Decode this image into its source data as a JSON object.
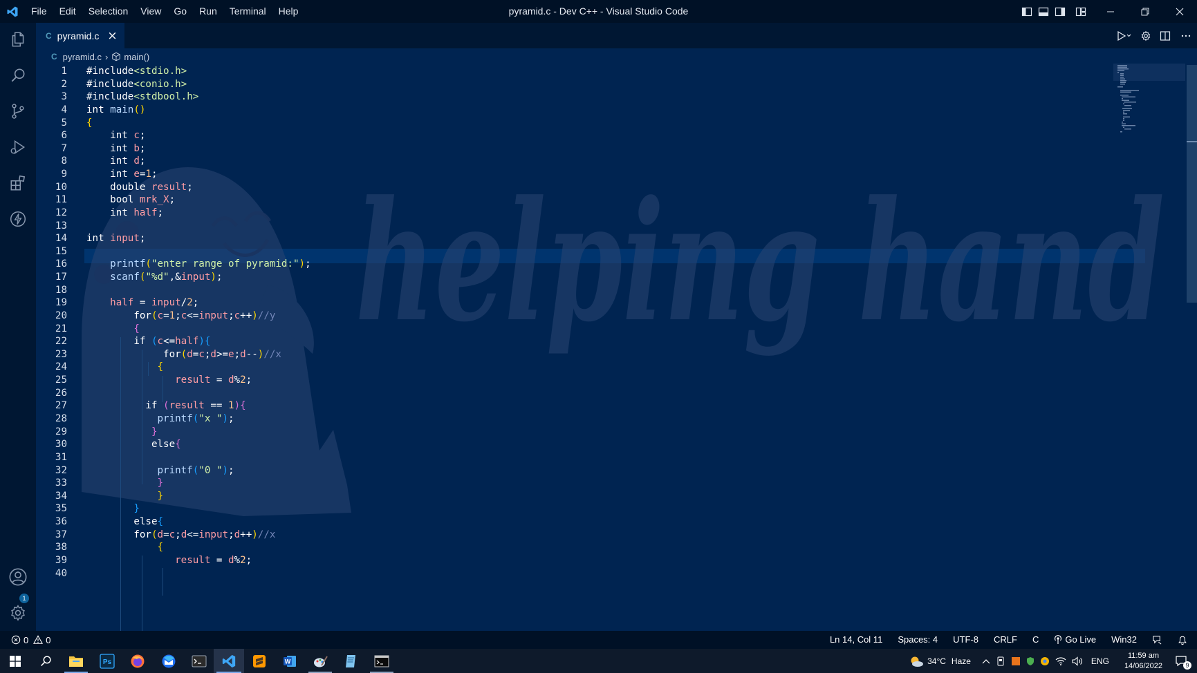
{
  "colors": {
    "editor_bg": "#002451",
    "keyword": "#ffffff",
    "string": "#d1f1a9",
    "function": "#bbdaff",
    "bracket_yellow": "#ffd700",
    "bracket_pink": "#da70d6",
    "bracket_blue": "#179fff",
    "comment": "#7285b7",
    "variable": "#ff9da4",
    "number": "#ffc58f"
  },
  "titlebar": {
    "menu": [
      "File",
      "Edit",
      "Selection",
      "View",
      "Go",
      "Run",
      "Terminal",
      "Help"
    ],
    "title": "pyramid.c - Dev C++ - Visual Studio Code"
  },
  "tab": {
    "icon_text": "C",
    "label": "pyramid.c"
  },
  "breadcrumb": {
    "icon_text": "C",
    "file": "pyramid.c",
    "symbol": "main()"
  },
  "watermark": {
    "text": "helping hand"
  },
  "code": [
    {
      "ln": "1",
      "tokens": [
        [
          "#include",
          "#ffffff"
        ],
        [
          "<stdio.h>",
          "#d1f1a9"
        ]
      ]
    },
    {
      "ln": "2",
      "tokens": [
        [
          "#include",
          "#ffffff"
        ],
        [
          "<conio.h>",
          "#d1f1a9"
        ]
      ]
    },
    {
      "ln": "3",
      "tokens": [
        [
          "#include",
          "#ffffff"
        ],
        [
          "<stdbool.h>",
          "#d1f1a9"
        ]
      ]
    },
    {
      "ln": "4",
      "tokens": [
        [
          "int ",
          "#ffffff"
        ],
        [
          "main",
          "#bbdaff"
        ],
        [
          "()",
          "#ffd700"
        ]
      ]
    },
    {
      "ln": "5",
      "tokens": [
        [
          "{",
          "#ffd700"
        ]
      ]
    },
    {
      "ln": "6",
      "tokens": [
        [
          "    int ",
          "#ffffff"
        ],
        [
          "c",
          "#ff9da4"
        ],
        [
          ";",
          "#ffffff"
        ]
      ]
    },
    {
      "ln": "7",
      "tokens": [
        [
          "    int ",
          "#ffffff"
        ],
        [
          "b",
          "#ff9da4"
        ],
        [
          ";",
          "#ffffff"
        ]
      ]
    },
    {
      "ln": "8",
      "tokens": [
        [
          "    int ",
          "#ffffff"
        ],
        [
          "d",
          "#ff9da4"
        ],
        [
          ";",
          "#ffffff"
        ]
      ]
    },
    {
      "ln": "9",
      "tokens": [
        [
          "    int ",
          "#ffffff"
        ],
        [
          "e",
          "#ff9da4"
        ],
        [
          "=",
          "#ffffff"
        ],
        [
          "1",
          "#ffc58f"
        ],
        [
          ";",
          "#ffffff"
        ]
      ]
    },
    {
      "ln": "10",
      "tokens": [
        [
          "    double ",
          "#ffffff"
        ],
        [
          "result",
          "#ff9da4"
        ],
        [
          ";",
          "#ffffff"
        ]
      ]
    },
    {
      "ln": "11",
      "tokens": [
        [
          "    bool ",
          "#ffffff"
        ],
        [
          "mrk_X",
          "#ff9da4"
        ],
        [
          ";",
          "#ffffff"
        ]
      ]
    },
    {
      "ln": "12",
      "tokens": [
        [
          "    int ",
          "#ffffff"
        ],
        [
          "half",
          "#ff9da4"
        ],
        [
          ";",
          "#ffffff"
        ]
      ]
    },
    {
      "ln": "13",
      "tokens": []
    },
    {
      "ln": "14",
      "tokens": [
        [
          "int ",
          "#ffffff"
        ],
        [
          "input",
          "#ff9da4"
        ],
        [
          ";",
          "#ffffff"
        ]
      ]
    },
    {
      "ln": "15",
      "tokens": []
    },
    {
      "ln": "16",
      "tokens": [
        [
          "    ",
          "#ffffff"
        ],
        [
          "printf",
          "#bbdaff"
        ],
        [
          "(",
          "#ffd700"
        ],
        [
          "\"enter range of pyramid:\"",
          "#d1f1a9"
        ],
        [
          ")",
          "#ffd700"
        ],
        [
          ";",
          "#ffffff"
        ]
      ]
    },
    {
      "ln": "17",
      "tokens": [
        [
          "    ",
          "#ffffff"
        ],
        [
          "scanf",
          "#bbdaff"
        ],
        [
          "(",
          "#ffd700"
        ],
        [
          "\"%d\"",
          "#d1f1a9"
        ],
        [
          ",&",
          "#ffffff"
        ],
        [
          "input",
          "#ff9da4"
        ],
        [
          ")",
          "#ffd700"
        ],
        [
          ";",
          "#ffffff"
        ]
      ]
    },
    {
      "ln": "18",
      "tokens": []
    },
    {
      "ln": "19",
      "tokens": [
        [
          "    ",
          "#ffffff"
        ],
        [
          "half",
          "#ff9da4"
        ],
        [
          " = ",
          "#ffffff"
        ],
        [
          "input",
          "#ff9da4"
        ],
        [
          "/",
          "#ffffff"
        ],
        [
          "2",
          "#ffc58f"
        ],
        [
          ";",
          "#ffffff"
        ]
      ]
    },
    {
      "ln": "20",
      "tokens": [
        [
          "        ",
          "#ffffff"
        ],
        [
          "for",
          "#ffffff"
        ],
        [
          "(",
          "#ffd700"
        ],
        [
          "c",
          "#ff9da4"
        ],
        [
          "=",
          "#ffffff"
        ],
        [
          "1",
          "#ffc58f"
        ],
        [
          ";",
          "#ffffff"
        ],
        [
          "c",
          "#ff9da4"
        ],
        [
          "<=",
          "#ffffff"
        ],
        [
          "input",
          "#ff9da4"
        ],
        [
          ";",
          "#ffffff"
        ],
        [
          "c",
          "#ff9da4"
        ],
        [
          "++",
          "#ffffff"
        ],
        [
          ")",
          "#ffd700"
        ],
        [
          "//y",
          "#7285b7"
        ]
      ]
    },
    {
      "ln": "21",
      "tokens": [
        [
          "        ",
          "#ffffff"
        ],
        [
          "{",
          "#da70d6"
        ]
      ]
    },
    {
      "ln": "22",
      "tokens": [
        [
          "        ",
          "#ffffff"
        ],
        [
          "if ",
          "#ffffff"
        ],
        [
          "(",
          "#179fff"
        ],
        [
          "c",
          "#ff9da4"
        ],
        [
          "<=",
          "#ffffff"
        ],
        [
          "half",
          "#ff9da4"
        ],
        [
          ")",
          "#179fff"
        ],
        [
          "{",
          "#179fff"
        ]
      ]
    },
    {
      "ln": "23",
      "tokens": [
        [
          "             ",
          "#ffffff"
        ],
        [
          "for",
          "#ffffff"
        ],
        [
          "(",
          "#ffd700"
        ],
        [
          "d",
          "#ff9da4"
        ],
        [
          "=",
          "#ffffff"
        ],
        [
          "c",
          "#ff9da4"
        ],
        [
          ";",
          "#ffffff"
        ],
        [
          "d",
          "#ff9da4"
        ],
        [
          ">=",
          "#ffffff"
        ],
        [
          "e",
          "#ff9da4"
        ],
        [
          ";",
          "#ffffff"
        ],
        [
          "d",
          "#ff9da4"
        ],
        [
          "--",
          "#ffffff"
        ],
        [
          ")",
          "#ffd700"
        ],
        [
          "//x",
          "#7285b7"
        ]
      ]
    },
    {
      "ln": "24",
      "tokens": [
        [
          "            ",
          "#ffffff"
        ],
        [
          "{",
          "#ffd700"
        ]
      ]
    },
    {
      "ln": "25",
      "tokens": [
        [
          "               ",
          "#ffffff"
        ],
        [
          "result",
          "#ff9da4"
        ],
        [
          " = ",
          "#ffffff"
        ],
        [
          "d",
          "#ff9da4"
        ],
        [
          "%",
          "#ffffff"
        ],
        [
          "2",
          "#ffc58f"
        ],
        [
          ";",
          "#ffffff"
        ]
      ]
    },
    {
      "ln": "26",
      "tokens": []
    },
    {
      "ln": "27",
      "tokens": [
        [
          "          ",
          "#ffffff"
        ],
        [
          "if ",
          "#ffffff"
        ],
        [
          "(",
          "#da70d6"
        ],
        [
          "result",
          "#ff9da4"
        ],
        [
          " == ",
          "#ffffff"
        ],
        [
          "1",
          "#ffc58f"
        ],
        [
          ")",
          "#da70d6"
        ],
        [
          "{",
          "#da70d6"
        ]
      ]
    },
    {
      "ln": "28",
      "tokens": [
        [
          "            ",
          "#ffffff"
        ],
        [
          "printf",
          "#bbdaff"
        ],
        [
          "(",
          "#179fff"
        ],
        [
          "\"x \"",
          "#d1f1a9"
        ],
        [
          ")",
          "#179fff"
        ],
        [
          ";",
          "#ffffff"
        ]
      ]
    },
    {
      "ln": "29",
      "tokens": [
        [
          "           ",
          "#ffffff"
        ],
        [
          "}",
          "#da70d6"
        ]
      ]
    },
    {
      "ln": "30",
      "tokens": [
        [
          "           ",
          "#ffffff"
        ],
        [
          "else",
          "#ffffff"
        ],
        [
          "{",
          "#da70d6"
        ]
      ]
    },
    {
      "ln": "31",
      "tokens": []
    },
    {
      "ln": "32",
      "tokens": [
        [
          "            ",
          "#ffffff"
        ],
        [
          "printf",
          "#bbdaff"
        ],
        [
          "(",
          "#179fff"
        ],
        [
          "\"0 \"",
          "#d1f1a9"
        ],
        [
          ")",
          "#179fff"
        ],
        [
          ";",
          "#ffffff"
        ]
      ]
    },
    {
      "ln": "33",
      "tokens": [
        [
          "            ",
          "#ffffff"
        ],
        [
          "}",
          "#da70d6"
        ]
      ]
    },
    {
      "ln": "34",
      "tokens": [
        [
          "            ",
          "#ffffff"
        ],
        [
          "}",
          "#ffd700"
        ]
      ]
    },
    {
      "ln": "35",
      "tokens": [
        [
          "        ",
          "#ffffff"
        ],
        [
          "}",
          "#179fff"
        ]
      ]
    },
    {
      "ln": "36",
      "tokens": [
        [
          "        ",
          "#ffffff"
        ],
        [
          "else",
          "#ffffff"
        ],
        [
          "{",
          "#179fff"
        ]
      ]
    },
    {
      "ln": "37",
      "tokens": [
        [
          "        ",
          "#ffffff"
        ],
        [
          "for",
          "#ffffff"
        ],
        [
          "(",
          "#ffd700"
        ],
        [
          "d",
          "#ff9da4"
        ],
        [
          "=",
          "#ffffff"
        ],
        [
          "c",
          "#ff9da4"
        ],
        [
          ";",
          "#ffffff"
        ],
        [
          "d",
          "#ff9da4"
        ],
        [
          "<=",
          "#ffffff"
        ],
        [
          "input",
          "#ff9da4"
        ],
        [
          ";",
          "#ffffff"
        ],
        [
          "d",
          "#ff9da4"
        ],
        [
          "++",
          "#ffffff"
        ],
        [
          ")",
          "#ffd700"
        ],
        [
          "//x",
          "#7285b7"
        ]
      ]
    },
    {
      "ln": "38",
      "tokens": [
        [
          "            ",
          "#ffffff"
        ],
        [
          "{",
          "#ffd700"
        ]
      ]
    },
    {
      "ln": "39",
      "tokens": [
        [
          "               ",
          "#ffffff"
        ],
        [
          "result",
          "#ff9da4"
        ],
        [
          " = ",
          "#ffffff"
        ],
        [
          "d",
          "#ff9da4"
        ],
        [
          "%",
          "#ffffff"
        ],
        [
          "2",
          "#ffc58f"
        ],
        [
          ";",
          "#ffffff"
        ]
      ]
    },
    {
      "ln": "40",
      "tokens": []
    }
  ],
  "activity": {
    "badge": "1"
  },
  "statusbar": {
    "errors": "0",
    "warnings": "0",
    "position": "Ln 14, Col 11",
    "spaces": "Spaces: 4",
    "encoding": "UTF-8",
    "eol": "CRLF",
    "language": "C",
    "golive": "Go Live",
    "platform": "Win32"
  },
  "taskbar": {
    "weather_temp": "34°C",
    "weather_text": "Haze",
    "lang": "ENG",
    "time": "11:59 am",
    "date": "14/06/2022",
    "notification_count": "9"
  }
}
